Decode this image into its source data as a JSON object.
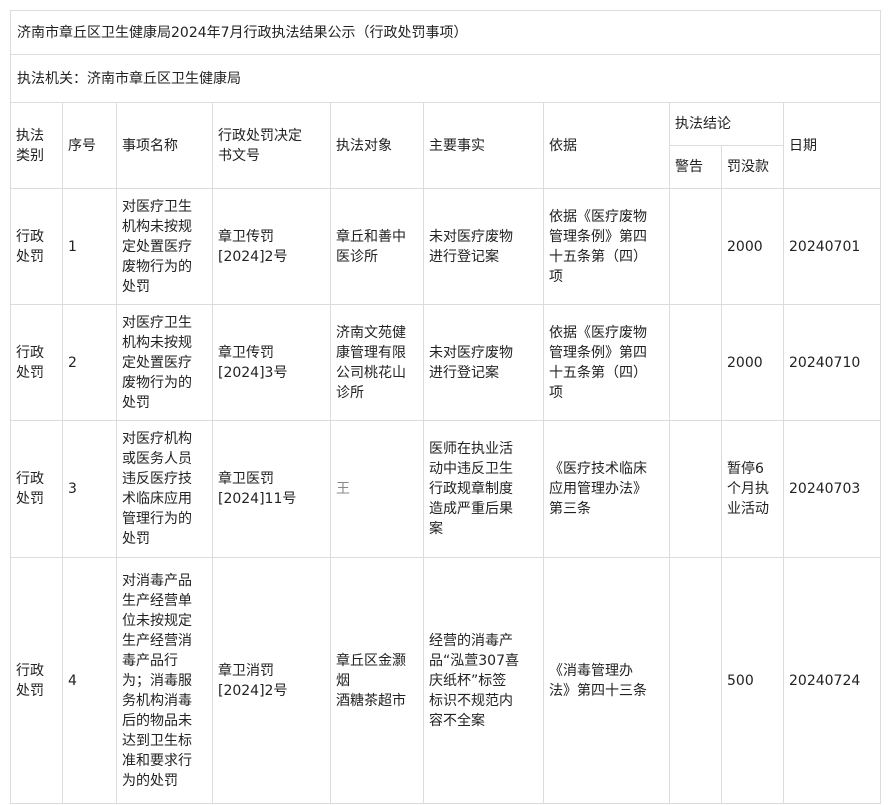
{
  "title": "济南市章丘区卫生健康局2024年7月行政执法结果公示（行政处罚事项）",
  "agency": "执法机关：济南市章丘区卫生健康局",
  "headers": {
    "category": "执法\n类别",
    "seq": "序号",
    "item": "事项名称",
    "doc_no": "行政处罚决定\n书文号",
    "target": "执法对象",
    "facts": "主要事实",
    "basis": "依据",
    "conclusion": "执法结论",
    "warning": "警告",
    "fine": "罚没款",
    "date": "日期"
  },
  "rows": [
    {
      "category": "行政\n处罚",
      "seq": "1",
      "item": "对医疗卫生\n机构未按规\n定处置医疗\n废物行为的\n处罚",
      "doc_no": "章卫传罚\n[2024]2号",
      "target": "章丘和善中\n医诊所",
      "facts": "未对医疗废物\n进行登记案",
      "basis": "依据《医疗废物\n管理条例》第四\n十五条第（四）\n项",
      "warning": "",
      "fine": "2000",
      "date": "20240701"
    },
    {
      "category": "行政\n处罚",
      "seq": "2",
      "item": "对医疗卫生\n机构未按规\n定处置医疗\n废物行为的\n处罚",
      "doc_no": "章卫传罚\n[2024]3号",
      "target": "济南文苑健\n康管理有限\n公司桃花山\n诊所",
      "facts": "未对医疗废物\n进行登记案",
      "basis": "依据《医疗废物\n管理条例》第四\n十五条第（四）\n项",
      "warning": "",
      "fine": "2000",
      "date": "20240710"
    },
    {
      "category": "行政\n处罚",
      "seq": "3",
      "item": "对医疗机构\n或医务人员\n违反医疗技\n术临床应用\n管理行为的\n处罚",
      "doc_no": "章卫医罚\n[2024]11号",
      "target": "王  ",
      "facts": "医师在执业活\n动中违反卫生\n行政规章制度\n造成严重后果\n案",
      "basis": "《医疗技术临床\n应用管理办法》\n第三条",
      "warning": "",
      "fine": "暂停6\n个月执\n业活动",
      "date": "20240703"
    },
    {
      "category": "行政\n处罚",
      "seq": "4",
      "item": "对消毒产品\n生产经营单\n位未按规定\n生产经营消\n毒产品行\n为；消毒服\n务机构消毒\n后的物品未\n达到卫生标\n准和要求行\n为的处罚",
      "doc_no": "章卫消罚\n[2024]2号",
      "target": "章丘区金灏\n烟\n酒糖茶超市",
      "facts": "经营的消毒产\n品“泓萱307喜\n庆纸杯”标签\n标识不规范内\n容不全案",
      "basis": "《消毒管理办\n法》第四十三条",
      "warning": "",
      "fine": "500",
      "date": "20240724"
    }
  ]
}
